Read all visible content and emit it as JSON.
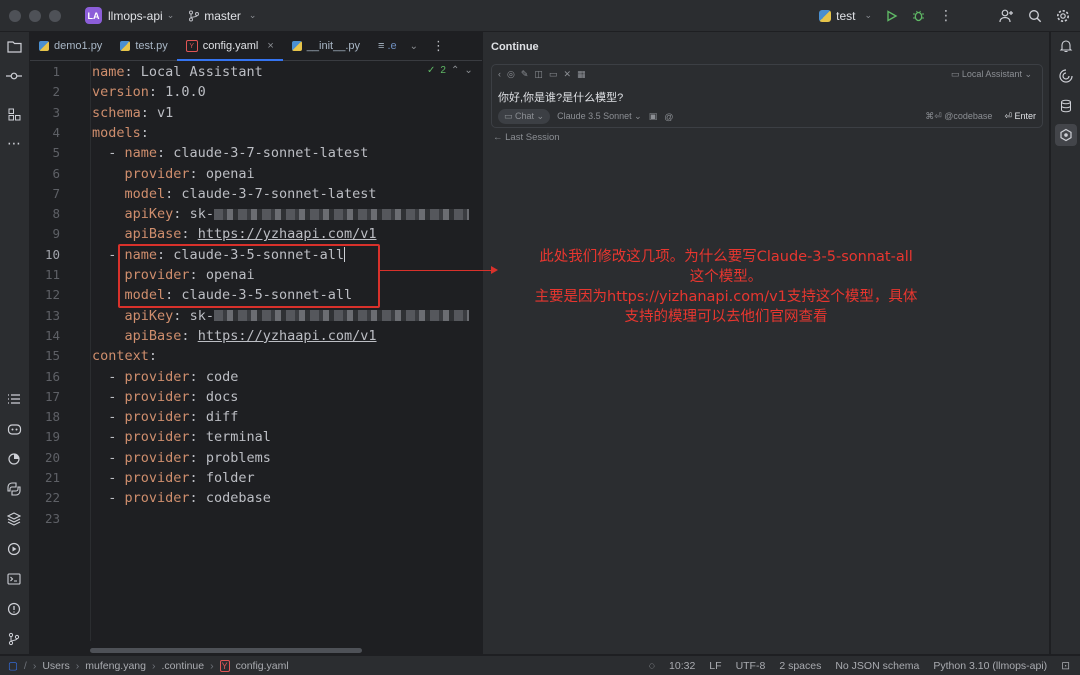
{
  "titlebar": {
    "project_badge": "LA",
    "project_name": "llmops-api",
    "branch": "master",
    "run_config": "test"
  },
  "tabs": [
    {
      "label": "demo1.py",
      "type": "python"
    },
    {
      "label": "test.py",
      "type": "python"
    },
    {
      "label": "config.yaml",
      "type": "yaml",
      "active": true
    },
    {
      "label": "__init__.py",
      "type": "python"
    },
    {
      "label": ".e",
      "type": "other"
    }
  ],
  "inspection": {
    "count": "2"
  },
  "editor": {
    "lines": [
      {
        "n": "1",
        "indent": "",
        "dash": false,
        "key": "name",
        "value": "Local Assistant"
      },
      {
        "n": "2",
        "indent": "",
        "dash": false,
        "key": "version",
        "value": "1.0.0"
      },
      {
        "n": "3",
        "indent": "",
        "dash": false,
        "key": "schema",
        "value": "v1"
      },
      {
        "n": "4",
        "indent": "",
        "dash": false,
        "key": "models",
        "value": ""
      },
      {
        "n": "5",
        "indent": "  ",
        "dash": true,
        "key": "name",
        "value": "claude-3-7-sonnet-latest"
      },
      {
        "n": "6",
        "indent": "    ",
        "dash": false,
        "key": "provider",
        "value": "openai"
      },
      {
        "n": "7",
        "indent": "    ",
        "dash": false,
        "key": "model",
        "value": "claude-3-7-sonnet-latest"
      },
      {
        "n": "8",
        "indent": "    ",
        "dash": false,
        "key": "apiKey",
        "value": "sk-",
        "masked": true
      },
      {
        "n": "9",
        "indent": "    ",
        "dash": false,
        "key": "apiBase",
        "value": "https://yzhaapi.com/v1",
        "link": true
      },
      {
        "n": "10",
        "indent": "  ",
        "dash": true,
        "key": "name",
        "value": "claude-3-5-sonnet-all",
        "current": true
      },
      {
        "n": "11",
        "indent": "    ",
        "dash": false,
        "key": "provider",
        "value": "openai"
      },
      {
        "n": "12",
        "indent": "    ",
        "dash": false,
        "key": "model",
        "value": "claude-3-5-sonnet-all"
      },
      {
        "n": "13",
        "indent": "    ",
        "dash": false,
        "key": "apiKey",
        "value": "sk-",
        "masked": true
      },
      {
        "n": "14",
        "indent": "    ",
        "dash": false,
        "key": "apiBase",
        "value": "https://yzhaapi.com/v1",
        "link": true
      },
      {
        "n": "15",
        "indent": "",
        "dash": false,
        "key": "context",
        "value": ""
      },
      {
        "n": "16",
        "indent": "  ",
        "dash": true,
        "key": "provider",
        "value": "code"
      },
      {
        "n": "17",
        "indent": "  ",
        "dash": true,
        "key": "provider",
        "value": "docs"
      },
      {
        "n": "18",
        "indent": "  ",
        "dash": true,
        "key": "provider",
        "value": "diff"
      },
      {
        "n": "19",
        "indent": "  ",
        "dash": true,
        "key": "provider",
        "value": "terminal"
      },
      {
        "n": "20",
        "indent": "  ",
        "dash": true,
        "key": "provider",
        "value": "problems"
      },
      {
        "n": "21",
        "indent": "  ",
        "dash": true,
        "key": "provider",
        "value": "folder"
      },
      {
        "n": "22",
        "indent": "  ",
        "dash": true,
        "key": "provider",
        "value": "codebase"
      },
      {
        "n": "23",
        "indent": "",
        "dash": false,
        "key": "",
        "value": ""
      }
    ]
  },
  "continue_panel": {
    "title": "Continue",
    "model_selector": "Local Assistant",
    "input_text": "你好,你是谁?是什么模型?",
    "mode": "Chat",
    "model": "Claude 3.5 Sonnet",
    "codebase_hint": "⌘⏎ @codebase",
    "enter_label": "⏎ Enter",
    "last_session": "Last Session"
  },
  "annotation": {
    "lines": [
      "此处我们修改这几项。为什么要写Claude-3-5-sonnat-all",
      "这个模型。",
      "主要是因为https://yizhanapi.com/v1支持这个模型，具体",
      "支持的模理可以去他们官网查看"
    ]
  },
  "statusbar": {
    "crumbs": [
      "Users",
      "mufeng.yang",
      ".continue",
      "config.yaml"
    ],
    "position": "10:32",
    "line_sep": "LF",
    "encoding": "UTF-8",
    "indent": "2 spaces",
    "schema": "No JSON schema",
    "interpreter": "Python 3.10 (llmops-api)"
  },
  "colors": {
    "accent": "#3574f0",
    "annotation_red": "#e8362f",
    "yaml_key": "#cf8e6d"
  }
}
